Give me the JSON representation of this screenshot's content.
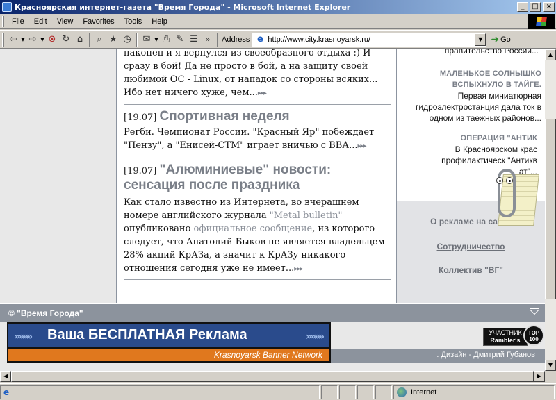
{
  "window": {
    "title": "Красноярская интернет-газета \"Время Города\" - Microsoft Internet Explorer",
    "buttons": {
      "minimize": "_",
      "maximize": "□",
      "close": "×"
    }
  },
  "menu": [
    "File",
    "Edit",
    "View",
    "Favorites",
    "Tools",
    "Help"
  ],
  "toolbar": {
    "icons": [
      "back-icon",
      "forward-icon",
      "stop-icon",
      "refresh-icon",
      "home-icon",
      "search-icon",
      "favorites-icon",
      "history-icon",
      "mail-icon",
      "print-icon",
      "edit-icon",
      "discuss-icon"
    ],
    "chevron": "»",
    "address_label": "Address",
    "url": "http://www.city.krasnoyarsk.ru/",
    "go_label": "Go"
  },
  "news": [
    {
      "date": "",
      "headline": "",
      "text": "наконец и я вернулся из своеобразного отдыха :) И сразу в бой! Да не просто в бой, а на защиту своей любимой ОС - Linux, от нападок со стороны всяких... Ибо нет ничего хуже, чем..."
    },
    {
      "date": "[19.07]",
      "headline": "Спортивная неделя",
      "text": "Регби. Чемпионат России. \"Красный Яр\" побеждает \"Пензу\", а \"Енисей-СТМ\" играет вничью с ВВА..."
    },
    {
      "date": "[19.07]",
      "headline": "\"Алюминиевые\" новости: сенсация после праздника",
      "text_1": "Как стало известно из Интернета, во вчерашнем номере английского журнала ",
      "link_1": "\"Metal bulletin\"",
      "text_2": " опубликовано ",
      "link_2": "официальное сообщение",
      "text_3": ", из которого следует, что Анатолий Быков не является владельцем 28% акций КрАЗа, а значит к КрАЗу никакого отношения сегодня уже не имеет..."
    }
  ],
  "more_arrows": "▸▸▸",
  "side_news": [
    {
      "title": "",
      "text": "правительство России..."
    },
    {
      "title": "МАЛЕНЬКОЕ СОЛНЫШКО ВСПЫХНУЛО В ТАЙГЕ.",
      "text": "Первая миниатюрная гидроэлектростанция дала ток в одном из таежных районов..."
    },
    {
      "title": "ОПЕРАЦИЯ \"АНТИК",
      "text": "В Красноярском крас профилактическ \"Антикв ат\"..."
    }
  ],
  "promo": [
    "О рекламе на сайте",
    "Сотрудничество",
    "Коллектив \"ВГ\""
  ],
  "footer": {
    "copyright": "© \"Время Города\"",
    "banner_main": "Ваша БЕСПЛАТНАЯ Реклама",
    "banner_sub": "Krasnoyarsk Banner Network",
    "banner_chevrons": "»»»»",
    "design": ". Дизайн - Дмитрий Губанов",
    "rambler": {
      "line1": "УЧАСТНИК",
      "line2": "Rambler's",
      "circle": "TOP 100"
    }
  },
  "status": {
    "zone": "Internet"
  },
  "colors": {
    "accent_gray": "#7a7f88",
    "footer_gray": "#8c939d",
    "banner_blue": "#2a4b8c",
    "banner_orange": "#e0781e"
  }
}
